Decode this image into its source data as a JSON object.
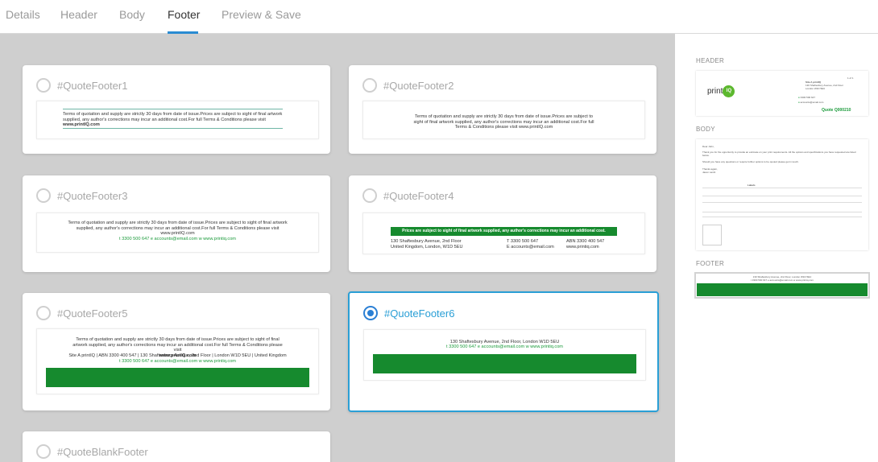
{
  "tabs": [
    {
      "label": "Details"
    },
    {
      "label": "Header"
    },
    {
      "label": "Body"
    },
    {
      "label": "Footer"
    },
    {
      "label": "Preview & Save"
    }
  ],
  "templates": [
    {
      "name": "#QuoteFooter1"
    },
    {
      "name": "#QuoteFooter2"
    },
    {
      "name": "#QuoteFooter3"
    },
    {
      "name": "#QuoteFooter4"
    },
    {
      "name": "#QuoteFooter5"
    },
    {
      "name": "#QuoteFooter6"
    },
    {
      "name": "#QuoteBlankFooter"
    }
  ],
  "footer_text": {
    "terms_a": "Terms of quotation and supply are strictly 30 days from date of issue.Prices are subject to sight of final artwork supplied, any author's corrections may incur an additional cost.For full Terms & Conditions please visit",
    "website_bold": "www.printIQ.com",
    "terms_b": "Terms of quotation and supply are strictly 30 days from date of issue.Prices are subject to sight of final artwork supplied, any author's corrections may incur an additional cost.For full Terms & Conditions please visit www.printIQ.com",
    "website_plain": "www.printIQ.com",
    "phone_line": "t 3300 500 647  e accounts@email.com  w www.printiq.com",
    "banner": "Prices are subject to sight of final artwork supplied, any author's corrections may incur an additional cost.",
    "addr1": "130 Shaftesbury Avenue, 2nd Floor",
    "addr2": "United Kingdom, London, W1D 5EU",
    "t_phone": "T 3300 500 647",
    "e_email": "E accounts@email.com",
    "abn": "ABN 3300 400 547",
    "www": "www.printiq.com",
    "site_line": "Site A printIQ | ABN 3300 400 547 | 130 Shaftesbury Avenue, 2nd Floor | London W1D 5EU | United Kingdom",
    "addr_single": "130 Shaftesbury Avenue, 2nd Floor, London W1D 5EU"
  },
  "preview": {
    "header_label": "HEADER",
    "body_label": "BODY",
    "footer_label": "FOOTER",
    "logo_text": "print",
    "logo_iq": "IQ",
    "page_of": "1 of 1",
    "company": "Site A printIQ",
    "company_addr1": "130 Shaftesbury Avenue, 2nd Floor",
    "company_addr2": "London W1D 5EU",
    "phone": "3300 500 647",
    "email": "accounts@email.com",
    "quote_no": "Quote Q000210",
    "body_dear": "Dear John,",
    "body_p1": "Thank you for the opportunity to provide an estimate on your print requirements. All the options and specifications you have requested are listed below.",
    "body_p2": "Should you have any questions or require further options to be quoted please get in touch.",
    "body_thanks": "Thanks again,",
    "body_name": "Jason Lamb",
    "labels_title": "Labels",
    "footer_addr": "130 Shaftesbury Avenue, 2nd Floor, London W1D 5EU",
    "footer_contact": "t 3300 500 647  e accounts@email.com  w www.printiq.com"
  }
}
